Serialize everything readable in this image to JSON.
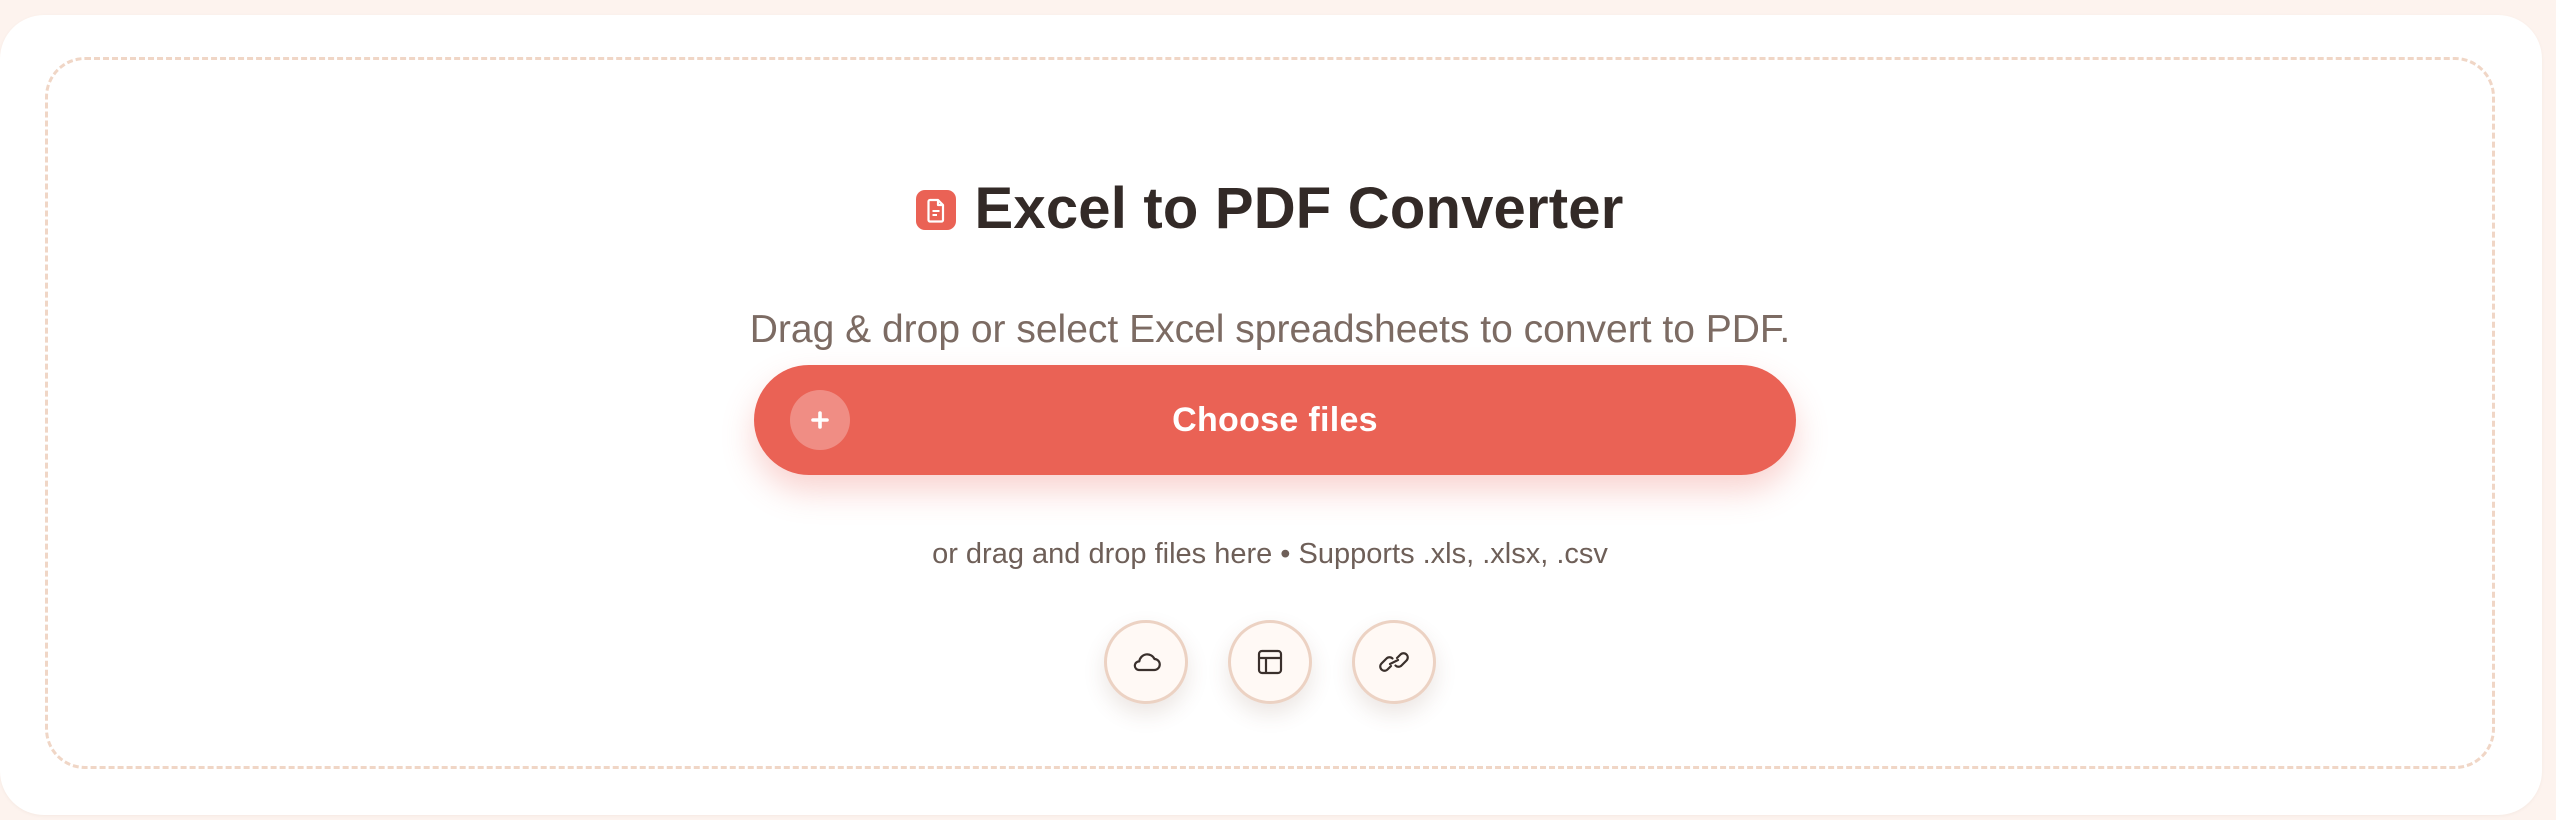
{
  "header": {
    "icon": "document-icon",
    "title": "Excel to PDF Converter",
    "subtitle": "Drag & drop or select Excel spreadsheets to convert to PDF."
  },
  "upload": {
    "button_label": "Choose files",
    "button_icon": "plus-icon",
    "hint": "or drag and drop files here • Supports .xls, .xlsx, .csv"
  },
  "sources": [
    {
      "icon": "cloud-icon"
    },
    {
      "icon": "table-icon"
    },
    {
      "icon": "link-icon"
    }
  ],
  "colors": {
    "accent": "#ea6255",
    "page_background": "#fdf3ee",
    "card_background": "#ffffff",
    "dashed_border": "#f0d6c6",
    "title_text": "#332a27",
    "muted_text": "#7c6b63"
  }
}
